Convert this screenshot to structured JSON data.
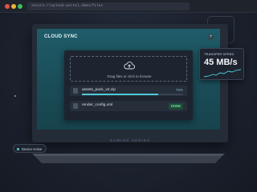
{
  "browser": {
    "url": "secure://upload-portal.demo/files"
  },
  "header": {
    "title": "CLOUD SYNC",
    "corner_button": "+"
  },
  "dropzone": {
    "text": "Drag files or click to browse"
  },
  "files": [
    {
      "name": "assets_pack_v2.zip",
      "progress_label": "75%",
      "progress": 0.75
    },
    {
      "name": "render_config.xml",
      "status": "DONE"
    }
  ],
  "transfer": {
    "label": "TRANSFER SPEED",
    "value": "45 MB/s"
  },
  "brand": {
    "text": "GAMING SERIES"
  },
  "device": {
    "status": "Device Active"
  },
  "colors": {
    "accent": "#4ec9d8",
    "done": "#6fe39b",
    "screen": "#1a4d58"
  }
}
